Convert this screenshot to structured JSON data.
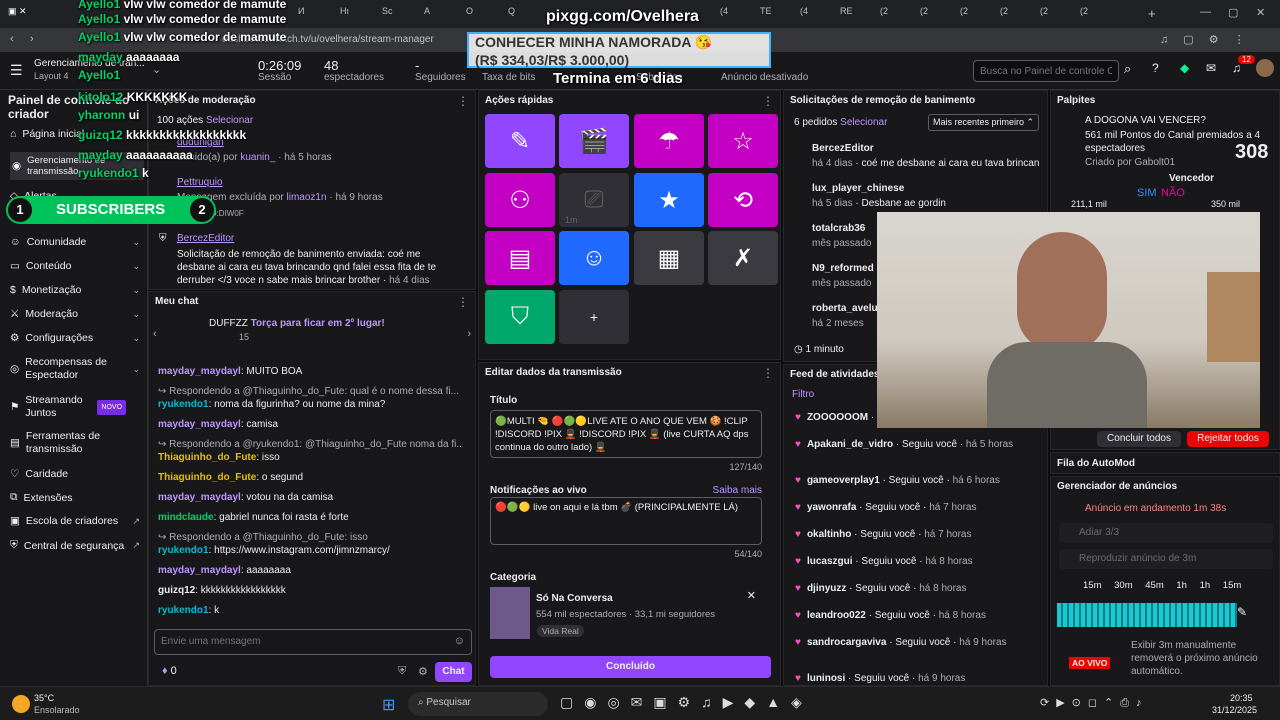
{
  "browser": {
    "tab_labels": [
      "И",
      "Нı",
      "Sc",
      "A",
      "O",
      "Q",
      "R(",
      "N",
      "(2",
      "(4",
      "TE",
      "(4",
      "RE",
      "(2",
      "(2",
      "(2",
      "(2",
      "(2",
      "(2",
      "(2"
    ],
    "url": "dashboard.twitch.tv/u/ovelhera/stream-manager"
  },
  "overlay": {
    "site": "pixgg.com/Ovelhera",
    "goal_title": "CONHECER MINHA NAMORADA 😘",
    "goal_amount": "(R$ 334,03/R$ 3.000,00)",
    "goal_end": "Termina em 6 dias",
    "subscribers_label": "SUBSCRIBERS",
    "subscribers_left": "1",
    "subscribers_right": "2",
    "chat_overlay": [
      {
        "user": "Ayello1",
        "msg": "vlw vlw comedor de mamute"
      },
      {
        "user": "Ayello1",
        "msg": "vlw vlw comedor de mamute"
      },
      {
        "user": "Ayello1",
        "msg": "vlw vlw comedor de mamute"
      },
      {
        "user": "mayday",
        "msg": "aaaaaaaa"
      },
      {
        "user": "Ayello1",
        "msg": ""
      },
      {
        "user": "kitolo12",
        "msg": "KKKKKKK"
      },
      {
        "user": "yharonn",
        "msg": "ui"
      },
      {
        "user": "guizq12",
        "msg": "kkkkkkkkkkkkkkkkkk"
      },
      {
        "user": "mayday",
        "msg": "aaaaaaaaaa"
      },
      {
        "user": "ryukendo1",
        "msg": "k"
      }
    ]
  },
  "header": {
    "title": "Painel de controle do criador",
    "subtitle": "Gerenciamento de tran...",
    "layout": "Layout 4",
    "session_val": "0:26:09",
    "session_lbl": "Sessão",
    "viewers_val": "48",
    "viewers_lbl": "espectadores",
    "followers_val": "-",
    "followers_lbl": "Seguidores",
    "bitrate_lbl": "Taxa de bits",
    "subs_lbl": "Subscritos",
    "ads_lbl": "Anúncio desativado",
    "search_placeholder": "Busca no Painel de controle C",
    "notif_count": "12"
  },
  "sidebar": {
    "items": [
      {
        "label": "Página inicial"
      },
      {
        "label": "Gerenciamento de transmissão"
      },
      {
        "label": "Alertas"
      },
      {
        "label": "Comunidade"
      },
      {
        "label": "Conteúdo"
      },
      {
        "label": "Monetização"
      },
      {
        "label": "Moderação"
      },
      {
        "label": "Configurações"
      },
      {
        "label": "Recompensas de Espectador"
      },
      {
        "label": "Streamando Juntos",
        "badge": "NOVO"
      },
      {
        "label": "Ferramentas de transmissão"
      },
      {
        "label": "Caridade"
      },
      {
        "label": "Extensões"
      },
      {
        "label": "Escola de criadores"
      },
      {
        "label": "Central de segurança"
      }
    ]
  },
  "mod_actions": {
    "title": "Ações de moderação",
    "count": "100 ações",
    "select": "Selecionar",
    "entries": [
      {
        "user": "dudunigan",
        "text": "Banido(a) por",
        "by": "kuanin_",
        "time": "há 5 horas"
      },
      {
        "user": "Pettruquio",
        "text": "Mensagem excluída por",
        "by": "limaoz1n",
        "time": "há 9 horas",
        "extra": "is:AUXILIO:DIW0F"
      },
      {
        "user": "BercezEditor",
        "text": "Solicitação de remoção de banimento enviada: coé me desbane ai cara eu tava brincando qnd falei essa fita de te derruber </3 voce n sabe mais brincar brother",
        "time": "há 4 dias"
      }
    ]
  },
  "chat": {
    "title": "Meu chat",
    "hype_user": "DUFFZZ",
    "hype_text": "Torça para ficar em 2º lugar!",
    "hype_count": "15",
    "input_placeholder": "Envie uma mensagem",
    "points": "0",
    "send": "Chat",
    "lines": [
      {
        "user": "mayday_maydayl",
        "msg": "MUITO BOA",
        "color": "purple"
      },
      {
        "reply": "Respondendo a @Thiaguinho_do_Fute: qual é o nome dessa fi..."
      },
      {
        "user": "ryukendo1",
        "msg": "noma da figurinha? ou nome da mina?",
        "color": "cyan"
      },
      {
        "user": "mayday_maydayl",
        "msg": "camisa",
        "color": "purple"
      },
      {
        "reply": "Respondendo a @ryukendo1: @Thiaguinho_do_Fute noma da fi..."
      },
      {
        "user": "Thiaguinho_do_Fute",
        "msg": "isso",
        "color": "yellow"
      },
      {
        "user": "Thiaguinho_do_Fute",
        "msg": "o segund",
        "color": "yellow"
      },
      {
        "user": "mayday_maydayl",
        "msg": "votou na da camisa",
        "color": "purple"
      },
      {
        "user": "mindclaude",
        "msg": "gabriel nunca foi rasta é forte",
        "color": "green"
      },
      {
        "reply": "Respondendo a @Thiaguinho_do_Fute: isso"
      },
      {
        "user": "ryukendo1",
        "msg": "https://www.instagram.com/jimnzmarcy/",
        "color": "cyan"
      },
      {
        "user": "mayday_maydayl",
        "msg": "aaaaaaaa",
        "color": "purple"
      },
      {
        "user": "guizq12",
        "msg": "kkkkkkkkkkkkkkkkk",
        "color": "plain"
      },
      {
        "user": "ryukendo1",
        "msg": "k",
        "color": "cyan"
      }
    ]
  },
  "quick_actions": {
    "title": "Ações rápidas",
    "add": "+",
    "timer": "1m"
  },
  "edit": {
    "title": "Editar dados da transmissão",
    "title_lbl": "Título",
    "title_val": "🟢MULTI 🤏 🔴🟢🟡LIVE ATE O ANO QUE VEM 🍪 !CLIP !DISCORD !PIX 💂 !DISCORD !PIX 💂 (live CURTA AQ dps continua do outro lado) 💂",
    "title_count": "127/140",
    "notif_lbl": "Notificações ao vivo",
    "learn_more": "Saiba mais",
    "notif_val": "🔴🟢🟡  live on aqui e lá tbm 💣 (PRINCIPALMENTE LÁ)",
    "notif_count": "54/140",
    "category_lbl": "Categoria",
    "category_name": "Só Na Conversa",
    "category_stats": "554 mil espectadores  ·  33,1 mi seguidores",
    "category_tag": "Vida Real",
    "done": "Concluído"
  },
  "unban": {
    "title": "Solicitações de remoção de banimento",
    "count": "6 pedidos",
    "select": "Selecionar",
    "sort": "Mais recentes primeiro",
    "entries": [
      {
        "user": "BercezEditor",
        "time": "há 4 dias",
        "msg": "coé me desbane ai cara eu tava brincan"
      },
      {
        "user": "lux_player_chinese",
        "time": "há 5 dias",
        "msg": "Desbane ae gordin"
      },
      {
        "user": "totalcrab36",
        "time": "mês passado",
        "msg": ""
      },
      {
        "user": "N9_reformed",
        "time": "mês passado",
        "msg": ""
      },
      {
        "user": "roberta_aveluc",
        "time": "há 2 meses",
        "msg": ""
      }
    ],
    "timer": "1 minuto"
  },
  "activity": {
    "title": "Feed de atividades",
    "filter": "Filtro",
    "entries": [
      {
        "user": "ZOOOOOOM",
        "action": "",
        "time": ""
      },
      {
        "user": "Apakani_de_vidro",
        "action": "Seguiu você",
        "time": "há 5 horas"
      },
      {
        "user": "gameoverplay1",
        "action": "Seguiu você",
        "time": "há 6 horas"
      },
      {
        "user": "yawonrafa",
        "action": "Seguiu você",
        "time": "há 7 horas"
      },
      {
        "user": "okaltinho",
        "action": "Seguiu você",
        "time": "há 7 horas"
      },
      {
        "user": "lucaszgui",
        "action": "Seguiu você",
        "time": "há 8 horas"
      },
      {
        "user": "djinyuzz",
        "action": "Seguiu você",
        "time": "há 8 horas"
      },
      {
        "user": "leandroo022",
        "action": "Seguiu você",
        "time": "há 8 horas"
      },
      {
        "user": "sandrocargaviva",
        "action": "Seguiu você",
        "time": "há 9 horas"
      },
      {
        "user": "luninosi",
        "action": "Seguiu você",
        "time": "há 9 horas"
      }
    ]
  },
  "predictions": {
    "title": "Palpites",
    "question": "A DOGONA VAI VENCER?",
    "points": "561 mil Pontos do Canal premiados a 4 espectadores",
    "created": "Criado por Gabolt01",
    "big_number": "308",
    "winner": "Vencedor",
    "yes": "SIM",
    "no": "NÃO",
    "left_pts": "211,1 mil",
    "right_pts": "350 mil",
    "finish_all": "Concluir todos",
    "reject_all": "Rejeitar todos"
  },
  "automod": {
    "title": "Fila do AutoMod"
  },
  "ads": {
    "title": "Gerenciador de anúncios",
    "running": "Anúncio em andamento",
    "running_time": "1m 38s",
    "snooze": "Adiar 3/3",
    "play": "Reproduzir anúncio de 3m",
    "ticks": [
      "15m",
      "30m",
      "45m",
      "1h",
      "1h 15m"
    ],
    "live": "AO VIVO",
    "note": "Exibir 3m manualmente removerá o próximo anúncio automático."
  },
  "taskbar": {
    "temp": "35°C",
    "weather": "Ensolarado",
    "search": "Pesquisar",
    "time": "20:35",
    "date": "31/12/2025"
  }
}
